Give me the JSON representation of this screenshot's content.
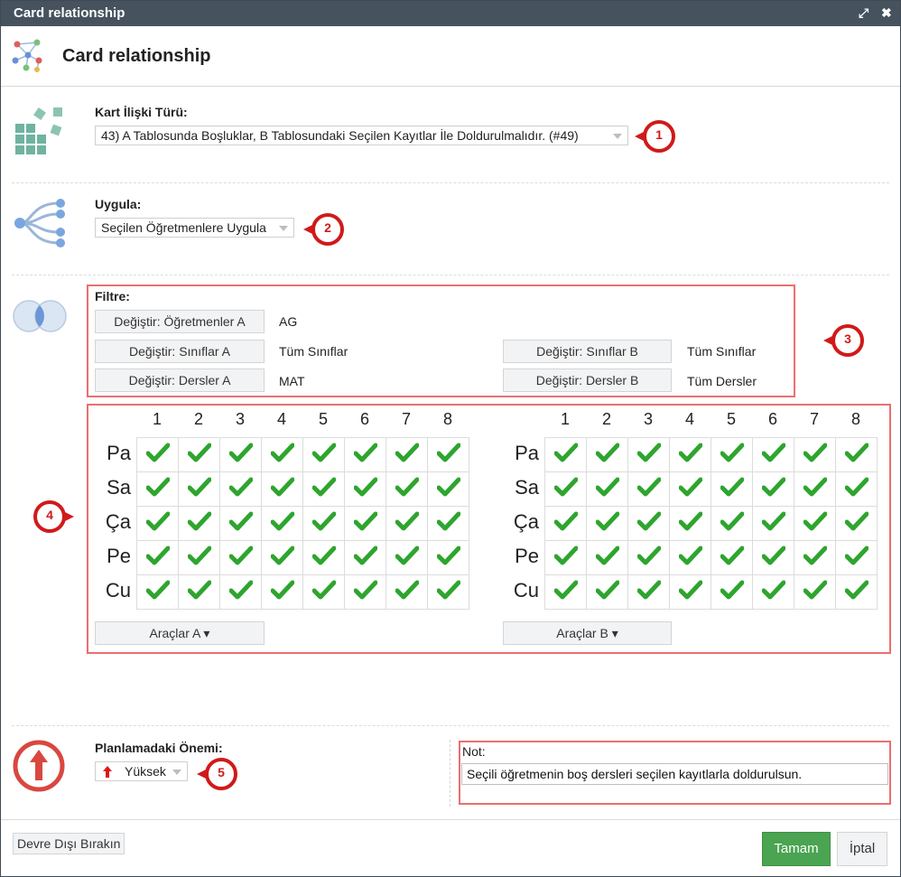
{
  "window": {
    "title": "Card relationship",
    "maximize_icon": "⤢",
    "close_icon": "✖"
  },
  "header": {
    "title": "Card relationship"
  },
  "relation_type": {
    "label": "Kart İlişki Türü:",
    "value": "43) A Tablosunda Boşluklar, B Tablosundaki Seçilen Kayıtlar İle Doldurulmalıdır. (#49)"
  },
  "apply": {
    "label": "Uygula:",
    "value": "Seçilen Öğretmenlere Uygula"
  },
  "filter": {
    "label": "Filtre:",
    "teachers_a": {
      "button": "Değiştir: Öğretmenler A",
      "value": "AG"
    },
    "classes_a": {
      "button": "Değiştir: Sınıflar A",
      "value": "Tüm Sınıflar"
    },
    "lessons_a": {
      "button": "Değiştir: Dersler A",
      "value": "MAT"
    },
    "classes_b": {
      "button": "Değiştir: Sınıflar B",
      "value": "Tüm Sınıflar"
    },
    "lessons_b": {
      "button": "Değiştir: Dersler B",
      "value": "Tüm Dersler"
    }
  },
  "grid_a": {
    "periods": [
      "1",
      "2",
      "3",
      "4",
      "5",
      "6",
      "7",
      "8"
    ],
    "days": [
      "Pa",
      "Sa",
      "Ça",
      "Pe",
      "Cu"
    ],
    "checked": [
      [
        true,
        true,
        true,
        true,
        true,
        true,
        true,
        true
      ],
      [
        true,
        true,
        true,
        true,
        true,
        true,
        true,
        true
      ],
      [
        true,
        true,
        true,
        true,
        true,
        true,
        true,
        true
      ],
      [
        true,
        true,
        true,
        true,
        true,
        true,
        true,
        true
      ],
      [
        true,
        true,
        true,
        true,
        true,
        true,
        true,
        true
      ]
    ],
    "tools_button": "Araçlar A ▾"
  },
  "grid_b": {
    "periods": [
      "1",
      "2",
      "3",
      "4",
      "5",
      "6",
      "7",
      "8"
    ],
    "days": [
      "Pa",
      "Sa",
      "Ça",
      "Pe",
      "Cu"
    ],
    "checked": [
      [
        true,
        true,
        true,
        true,
        true,
        true,
        true,
        true
      ],
      [
        true,
        true,
        true,
        true,
        true,
        true,
        true,
        true
      ],
      [
        true,
        true,
        true,
        true,
        true,
        true,
        true,
        true
      ],
      [
        true,
        true,
        true,
        true,
        true,
        true,
        true,
        true
      ],
      [
        true,
        true,
        true,
        true,
        true,
        true,
        true,
        true
      ]
    ],
    "tools_button": "Araçlar B ▾"
  },
  "importance": {
    "label": "Planlamadaki Önemi:",
    "value": "Yüksek"
  },
  "note": {
    "label": "Not:",
    "value": "Seçili öğretmenin boş dersleri seçilen kayıtlarla doldurulsun."
  },
  "markers": [
    "1",
    "2",
    "3",
    "4",
    "5"
  ],
  "footer": {
    "disable_button": "Devre Dışı Bırakın",
    "ok_button": "Tamam",
    "cancel_button": "İptal"
  },
  "colors": {
    "titlebar": "#46525e",
    "accent_red": "#d01a1a",
    "highlight_box": "#ea6f6f",
    "check_green": "#2ea52e",
    "ok_green": "#4aa451",
    "icon_teal": "#6fb3a0",
    "icon_blue": "#7aa6e0"
  }
}
